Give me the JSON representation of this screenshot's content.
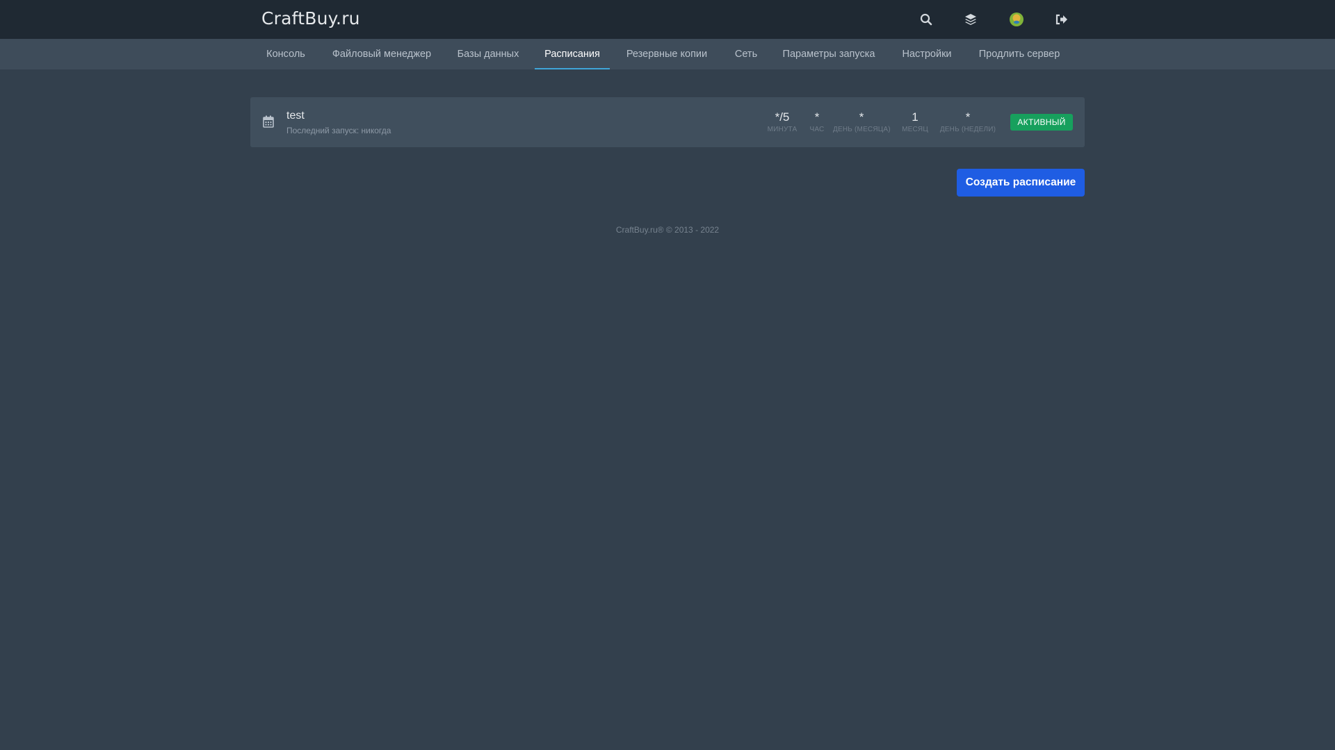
{
  "header": {
    "brand": "CraftBuy.ru",
    "icons": [
      "search-icon",
      "layers-icon",
      "avatar",
      "logout-icon"
    ]
  },
  "nav": {
    "tabs": [
      {
        "label": "Консоль",
        "active": false
      },
      {
        "label": "Файловый менеджер",
        "active": false
      },
      {
        "label": "Базы данных",
        "active": false
      },
      {
        "label": "Расписания",
        "active": true
      },
      {
        "label": "Резервные копии",
        "active": false
      },
      {
        "label": "Сеть",
        "active": false
      },
      {
        "label": "Параметры запуска",
        "active": false
      },
      {
        "label": "Настройки",
        "active": false
      },
      {
        "label": "Продлить сервер",
        "active": false
      }
    ]
  },
  "schedule": {
    "name": "test",
    "last_run": "Последний запуск: никогда",
    "cron": [
      {
        "value": "*/5",
        "label": "МИНУТА"
      },
      {
        "value": "*",
        "label": "ЧАС"
      },
      {
        "value": "*",
        "label": "ДЕНЬ (МЕСЯЦА)"
      },
      {
        "value": "1",
        "label": "МЕСЯЦ"
      },
      {
        "value": "*",
        "label": "ДЕНЬ (НЕДЕЛИ)"
      }
    ],
    "status": "АКТИВНЫЙ",
    "status_color": "#17a05d"
  },
  "actions": {
    "create_label": "Создать расписание"
  },
  "footer": {
    "text": "CraftBuy.ru® © 2013 - 2022"
  },
  "colors": {
    "background": "#33404d",
    "header": "#1f2933",
    "subnav": "#3e4c5a",
    "accent": "#3fa6d9",
    "primary_button": "#1f5de3"
  }
}
